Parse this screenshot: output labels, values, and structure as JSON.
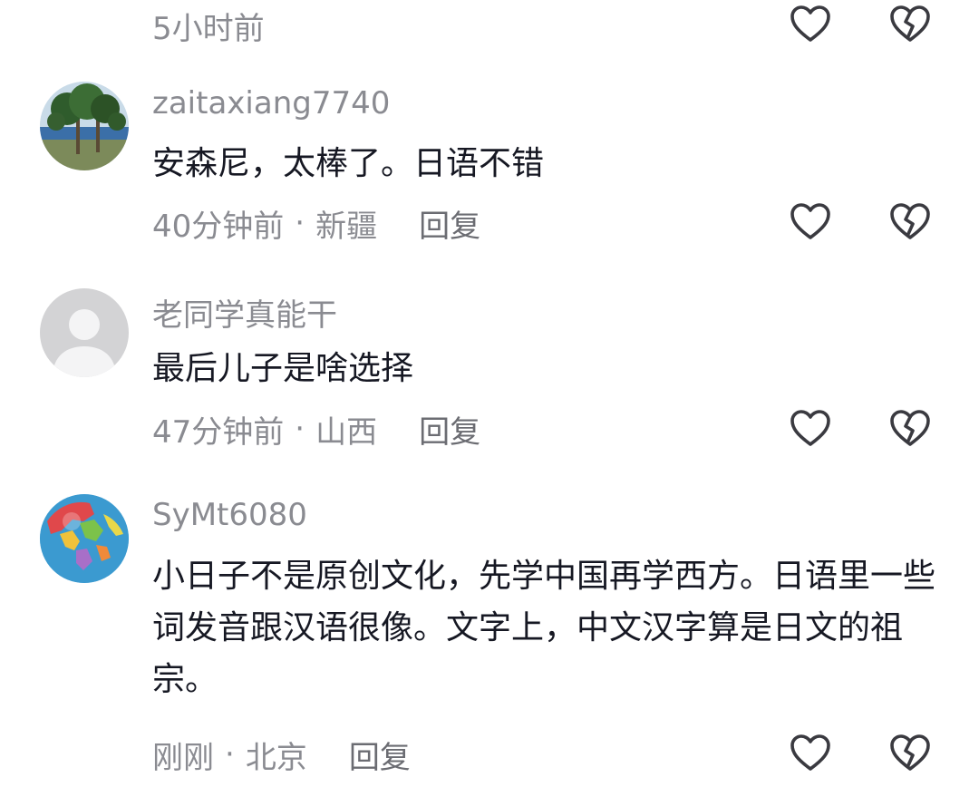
{
  "top_partial": {
    "time": "5小时前"
  },
  "comments": [
    {
      "username": "zaitaxiang7740",
      "text": "安森尼，太棒了。日语不错",
      "time": "40分钟前",
      "separator": "·",
      "location": "新疆",
      "reply_label": "回复",
      "avatar": "landscape-trees-avatar"
    },
    {
      "username": "老同学真能干",
      "text": "最后儿子是啥选择",
      "time": "47分钟前",
      "separator": "·",
      "location": "山西",
      "reply_label": "回复",
      "avatar": "default-person-avatar"
    },
    {
      "username": "SyMt6080",
      "text": "小日子不是原创文化，先学中国再学西方。日语里一些词发音跟汉语很像。文字上，中文汉字算是日文的祖宗。",
      "time": "刚刚",
      "separator": "·",
      "location": "北京",
      "reply_label": "回复",
      "avatar": "globe-avatar"
    }
  ],
  "icons": {
    "like": "heart-outline-icon",
    "dislike": "broken-heart-icon"
  },
  "colors": {
    "text": "#161823",
    "meta": "#8a8b91",
    "icon": "#3a3a40"
  }
}
